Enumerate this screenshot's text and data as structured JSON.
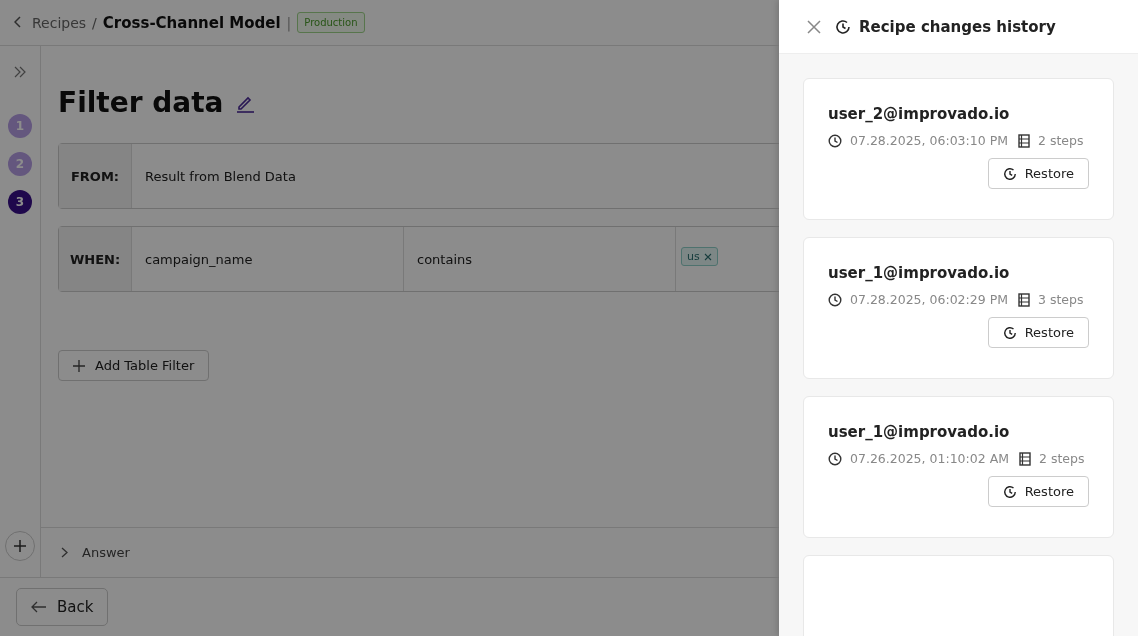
{
  "breadcrumb": {
    "parent": "Recipes",
    "separator": "/",
    "current": "Cross-Channel Model",
    "divider": "|",
    "badge": "Production"
  },
  "steps": [
    {
      "label": "1",
      "selected": false
    },
    {
      "label": "2",
      "selected": false
    },
    {
      "label": "3",
      "selected": true
    }
  ],
  "page_title": "Filter data",
  "from_row": {
    "label": "FROM:",
    "value": "Result from Blend Data"
  },
  "when_row": {
    "label": "WHEN:",
    "field": "campaign_name",
    "operator": "contains",
    "tags": [
      "us"
    ]
  },
  "add_filter_button": "Add Table Filter",
  "answer_section": {
    "label": "Answer",
    "expanded": false
  },
  "back_button": "Back",
  "drawer": {
    "title": "Recipe changes history",
    "entries": [
      {
        "user": "user_2@improvado.io",
        "timestamp": "07.28.2025, 06:03:10 PM",
        "steps": "2 steps",
        "action": "Restore"
      },
      {
        "user": "user_1@improvado.io",
        "timestamp": "07.28.2025, 06:02:29 PM",
        "steps": "3 steps",
        "action": "Restore"
      },
      {
        "user": "user_1@improvado.io",
        "timestamp": "07.26.2025, 01:10:02 AM",
        "steps": "2 steps",
        "action": "Restore"
      }
    ]
  }
}
